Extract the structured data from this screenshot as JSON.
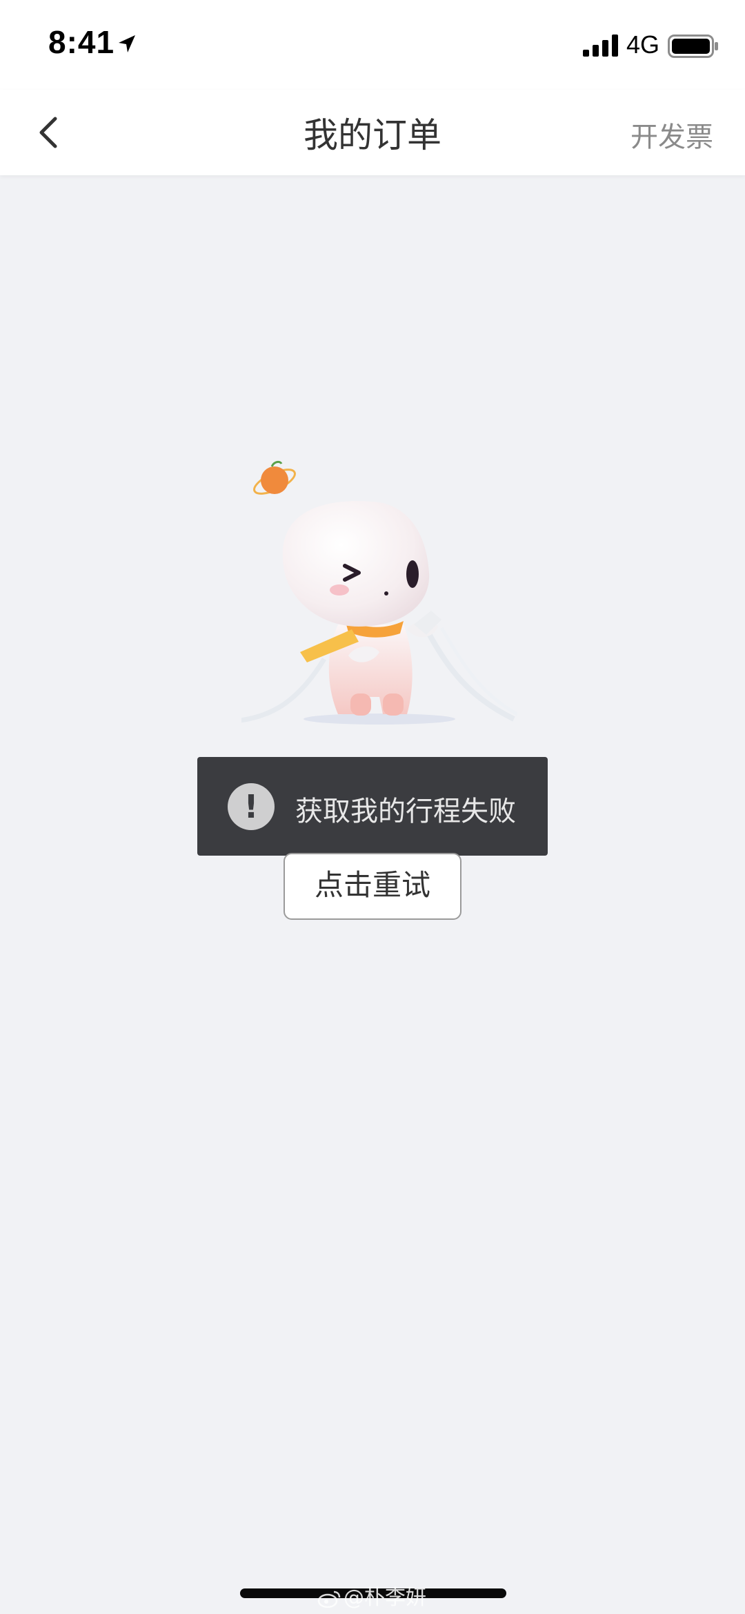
{
  "status_bar": {
    "time": "8:41",
    "network": "4G",
    "icons": [
      "location-arrow-icon",
      "signal-icon",
      "battery-icon"
    ]
  },
  "nav": {
    "back_icon": "chevron-left-icon",
    "title": "我的订单",
    "action_label": "开发票"
  },
  "empty_state": {
    "illustration": "mascot-unplugged-illustration",
    "toast_icon": "exclamation-icon",
    "toast_icon_glyph": "!",
    "toast_message": "获取我的行程失败",
    "retry_label": "点击重试"
  },
  "watermark": {
    "text": "@朴李妍",
    "icon": "weibo-icon"
  },
  "colors": {
    "page_background": "#f1f2f5",
    "toast_background": "#3b3c40",
    "nav_action_text": "#8a8a8a",
    "mascot_accent": "#f08a3c"
  }
}
